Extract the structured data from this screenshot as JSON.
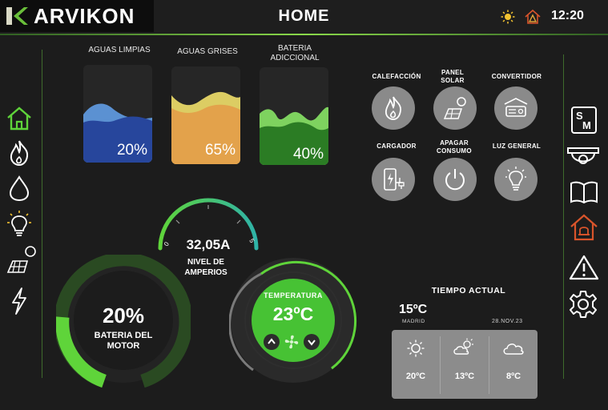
{
  "header": {
    "brand": "ARVIKON",
    "title": "HOME",
    "time": "12:20",
    "status_icons": [
      "sun-icon",
      "home-alert-icon"
    ]
  },
  "left_nav": [
    {
      "name": "home-icon",
      "active": true
    },
    {
      "name": "flame-icon"
    },
    {
      "name": "water-drop-icon"
    },
    {
      "name": "lightbulb-icon"
    },
    {
      "name": "solar-panel-icon"
    },
    {
      "name": "lightning-icon"
    }
  ],
  "right_nav": [
    {
      "name": "sm-logo-icon",
      "label": "S M"
    },
    {
      "name": "security-camera-icon"
    },
    {
      "name": "book-icon"
    },
    {
      "name": "home-alarm-icon"
    },
    {
      "name": "warning-icon"
    },
    {
      "name": "settings-icon"
    }
  ],
  "tanks": [
    {
      "label": "AGUAS LIMPIAS",
      "percent": "20%",
      "level": 0.2,
      "colors": {
        "front": "#27469c",
        "back": "#5b91d2"
      }
    },
    {
      "label": "AGUAS GRISES",
      "percent": "65%",
      "level": 0.65,
      "colors": {
        "front": "#e3a24b",
        "back": "#dccd63"
      }
    },
    {
      "label": "BATERIA ADICCIONAL",
      "percent": "40%",
      "level": 0.4,
      "colors": {
        "front": "#2b7c24",
        "back": "#7ed25f"
      }
    }
  ],
  "controls": [
    {
      "label": "CALEFACCIÓN",
      "icon": "flame-icon"
    },
    {
      "label": "PANEL SOLAR",
      "icon": "solar-panel-icon"
    },
    {
      "label": "CONVERTIDOR",
      "icon": "converter-icon"
    },
    {
      "label": "CARGADOR",
      "icon": "charger-icon"
    },
    {
      "label": "APAGAR CONSUMO",
      "icon": "power-icon"
    },
    {
      "label": "LUZ GENERAL",
      "icon": "lightbulb-icon"
    }
  ],
  "amp_gauge": {
    "value": "32,05A",
    "label_line1": "NIVEL DE",
    "label_line2": "AMPERIOS",
    "min": "0",
    "max": "5"
  },
  "battery_motor": {
    "percent": "20%",
    "level": 0.2,
    "label_line1": "BATERIA DEL",
    "label_line2": "MOTOR"
  },
  "thermostat": {
    "title": "TEMPERATURA",
    "value": "23ºC",
    "up_icon": "chevron-up-icon",
    "fan_icon": "fan-icon",
    "down_icon": "chevron-down-icon"
  },
  "weather": {
    "title": "TIEMPO ACTUAL",
    "current_temp": "15ºC",
    "city": "MADRID",
    "date": "28.NOV.23",
    "forecast": [
      {
        "icon": "sun-icon",
        "temp": "20ºC"
      },
      {
        "icon": "cloud-sun-icon",
        "temp": "13ºC"
      },
      {
        "icon": "cloud-icon",
        "temp": "8ºC"
      }
    ]
  },
  "accent": "#5fd43a"
}
